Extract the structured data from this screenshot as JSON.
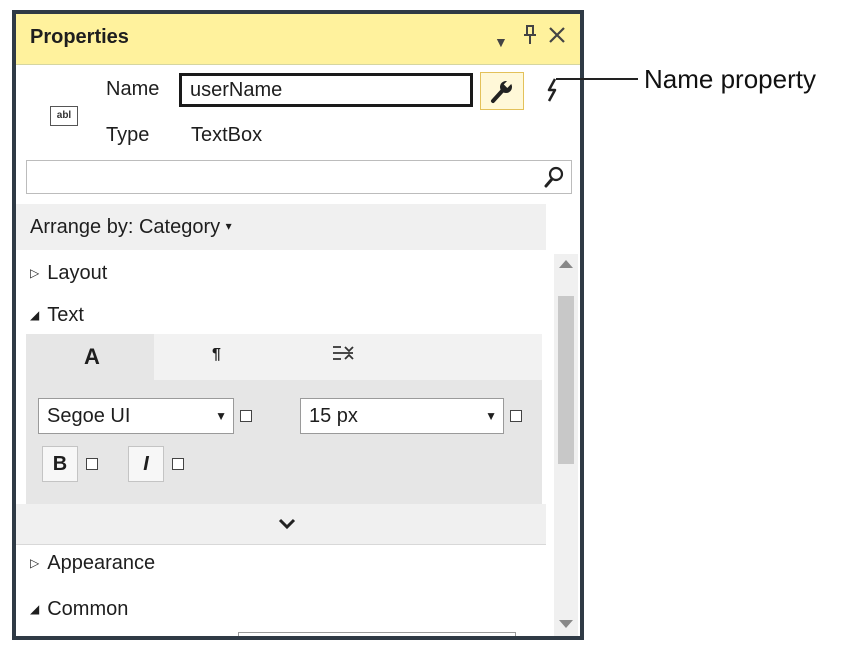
{
  "panel": {
    "title": "Properties",
    "title_buttons": {
      "dropdown": "▾",
      "pin": "𝟜",
      "close": "✕"
    }
  },
  "object": {
    "icon_text": "abl",
    "name_label": "Name",
    "name_value": "userName",
    "type_label": "Type",
    "type_value": "TextBox"
  },
  "toolbar": {
    "properties_icon": "wrench-icon",
    "events_icon": "lightning-icon"
  },
  "search": {
    "placeholder": "",
    "icon": "search-icon"
  },
  "arrange": {
    "label": "Arrange by: Category",
    "arrow": "▾"
  },
  "categories": {
    "layout": "Layout",
    "text": "Text",
    "appearance": "Appearance",
    "common": "Common"
  },
  "text_tabs": {
    "font": "A",
    "paragraph": "¶",
    "indent": "⇤"
  },
  "font": {
    "family": "Segoe UI",
    "size": "15 px",
    "bold": "B",
    "italic": "I"
  },
  "expander": {
    "icon": "chevron-down-icon"
  },
  "callout": {
    "text": "Name property"
  }
}
